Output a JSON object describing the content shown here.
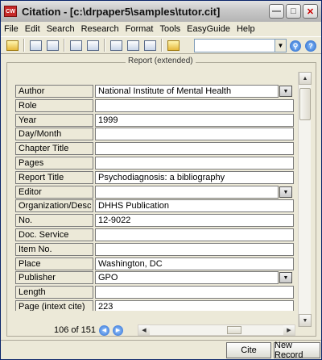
{
  "window": {
    "app_icon_text": "CW",
    "title": "Citation - [c:\\drpaper5\\samples\\tutor.cit]"
  },
  "menu": [
    "File",
    "Edit",
    "Search",
    "Research",
    "Format",
    "Tools",
    "EasyGuide",
    "Help"
  ],
  "toolbar": {
    "icons": [
      "open-folder-icon",
      "copy-icon",
      "paste-icon",
      "view-icon",
      "window-icon",
      "list-icon",
      "doc-icon",
      "print-icon",
      "insert-icon"
    ],
    "combo_value": "",
    "search_icon": "magnifier-icon",
    "help_icon": "help-icon"
  },
  "record": {
    "section_title": "Report (extended)",
    "fields": [
      {
        "label": "Author",
        "value": "National Institute of Mental Health",
        "dropdown": true
      },
      {
        "label": "Role",
        "value": "",
        "dropdown": false
      },
      {
        "label": "Year",
        "value": "1999",
        "dropdown": false
      },
      {
        "label": "Day/Month",
        "value": "",
        "dropdown": false
      },
      {
        "label": "Chapter Title",
        "value": "",
        "dropdown": false
      },
      {
        "label": "Pages",
        "value": "",
        "dropdown": false
      },
      {
        "label": "Report Title",
        "value": "Psychodiagnosis: a bibliography",
        "dropdown": false
      },
      {
        "label": "Editor",
        "value": "",
        "dropdown": true
      },
      {
        "label": "Organization/Desc",
        "value": "DHHS Publication",
        "dropdown": false
      },
      {
        "label": "No.",
        "value": "12-9022",
        "dropdown": false
      },
      {
        "label": "Doc. Service",
        "value": "",
        "dropdown": false
      },
      {
        "label": "Item No.",
        "value": "",
        "dropdown": false
      },
      {
        "label": "Place",
        "value": "Washington, DC",
        "dropdown": false
      },
      {
        "label": "Publisher",
        "value": "GPO",
        "dropdown": true
      },
      {
        "label": "Length",
        "value": "",
        "dropdown": false
      },
      {
        "label": "Page (intext cite)",
        "value": "223",
        "dropdown": false
      }
    ]
  },
  "navigation": {
    "record_count": "106 of 151"
  },
  "buttons": {
    "cite": "Cite",
    "new_record": "New Record"
  }
}
